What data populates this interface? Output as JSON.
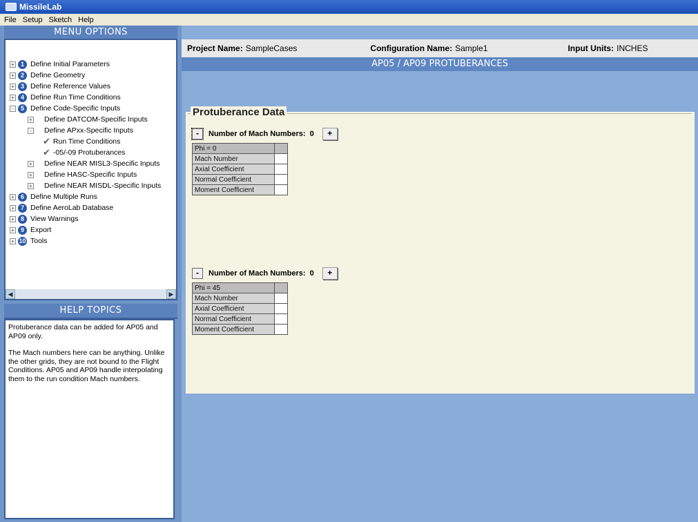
{
  "window": {
    "title": "MissileLab"
  },
  "menubar": [
    "File",
    "Setup",
    "Sketch",
    "Help"
  ],
  "menu_options": {
    "title": "MENU OPTIONS",
    "items": [
      {
        "num": "1",
        "label": "Define Initial Parameters",
        "expander": "+"
      },
      {
        "num": "2",
        "label": "Define Geometry",
        "expander": "+"
      },
      {
        "num": "3",
        "label": "Define Reference Values",
        "expander": "+"
      },
      {
        "num": "4",
        "label": "Define Run Time Conditions",
        "expander": "+"
      },
      {
        "num": "5",
        "label": "Define Code-Specific Inputs",
        "expander": "-"
      },
      {
        "label": "Define DATCOM-Specific Inputs",
        "expander": "+"
      },
      {
        "label": "Define APxx-Specific Inputs",
        "expander": "-"
      },
      {
        "label": "Run Time Conditions"
      },
      {
        "label": "-05/-09 Protuberances"
      },
      {
        "label": "Define NEAR MISL3-Specific Inputs",
        "expander": "+"
      },
      {
        "label": "Define HASC-Specific Inputs",
        "expander": "+"
      },
      {
        "label": "Define NEAR MISDL-Specific Inputs",
        "expander": "+"
      },
      {
        "num": "6",
        "label": "Define Multiple Runs",
        "expander": "+"
      },
      {
        "num": "7",
        "label": "Define AeroLab Database",
        "expander": "+"
      },
      {
        "num": "8",
        "label": "View Warnings",
        "expander": "+"
      },
      {
        "num": "9",
        "label": "Export",
        "expander": "+"
      },
      {
        "num": "10",
        "label": "Tools",
        "expander": "+"
      }
    ]
  },
  "help_topics": {
    "title": "HELP TOPICS",
    "para1": "Protuberance data can be added for AP05 and AP09 only.",
    "para2": "The Mach numbers here can be anything. Unlike the other grids, they are not bound to the Flight Conditions.  AP05 and AP09 handle interpolating them to the run condition Mach numbers."
  },
  "project": {
    "name_label": "Project Name:",
    "name_value": "SampleCases",
    "config_label": "Configuration Name:",
    "config_value": "Sample1",
    "units_label": "Input Units:",
    "units_value": "INCHES"
  },
  "page_title": "AP05 / AP09 PROTUBERANCES",
  "protuberance": {
    "legend": "Protuberance Data",
    "groups": [
      {
        "minus": "-",
        "plus": "+",
        "mach_label": "Number of Mach Numbers:",
        "mach_count": "0",
        "rows": [
          "Phi = 0",
          "Mach Number",
          "Axial Coefficient",
          "Normal Coefficient",
          "Moment Coefficient"
        ]
      },
      {
        "minus": "-",
        "plus": "+",
        "mach_label": "Number of Mach Numbers:",
        "mach_count": "0",
        "rows": [
          "Phi = 45",
          "Mach Number",
          "Axial Coefficient",
          "Normal Coefficient",
          "Moment Coefficient"
        ]
      }
    ]
  }
}
